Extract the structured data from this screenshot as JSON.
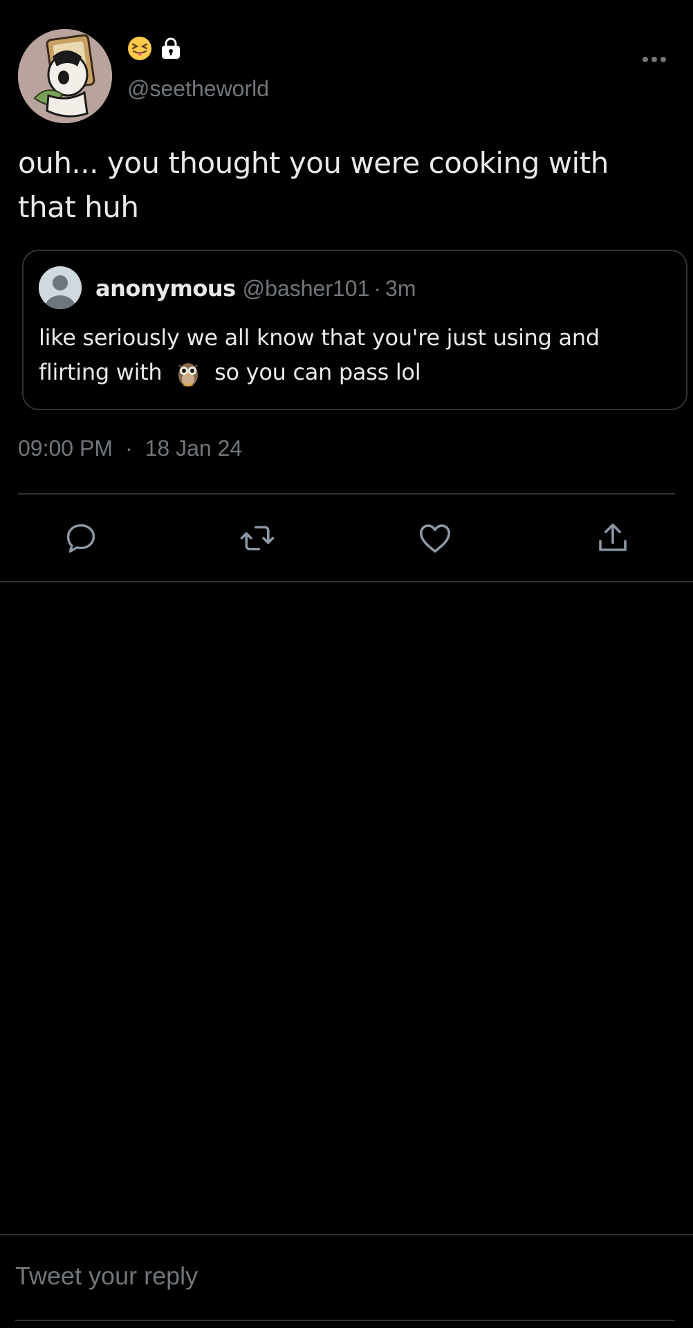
{
  "tweet": {
    "author_handle": "@seetheworld",
    "text": "ouh... you thought you were cooking with that huh",
    "time": "09:00 PM",
    "date": "18 Jan 24",
    "separator": "·"
  },
  "quoted_tweet": {
    "name": "anonymous",
    "handle": "@basher101",
    "separator": "·",
    "age": "3m",
    "text_before_emoji": "like seriously we all know that you're just using and flirting with",
    "emoji": "owl-emoji",
    "text_after_emoji": "so you can pass lol"
  },
  "actions": {
    "reply_icon": "speech-bubble-icon",
    "retweet_icon": "retweet-icon",
    "like_icon": "heart-icon",
    "share_icon": "share-icon"
  },
  "composer": {
    "placeholder": "Tweet your reply"
  },
  "icons": {
    "name_emoji": "squinting-tongue-face-emoji",
    "name_badge": "lock-icon",
    "more": "more-dots-icon"
  },
  "colors": {
    "background": "#000000",
    "text_primary": "#e7e9ea",
    "text_secondary": "#71767b",
    "border": "#2f3336"
  }
}
